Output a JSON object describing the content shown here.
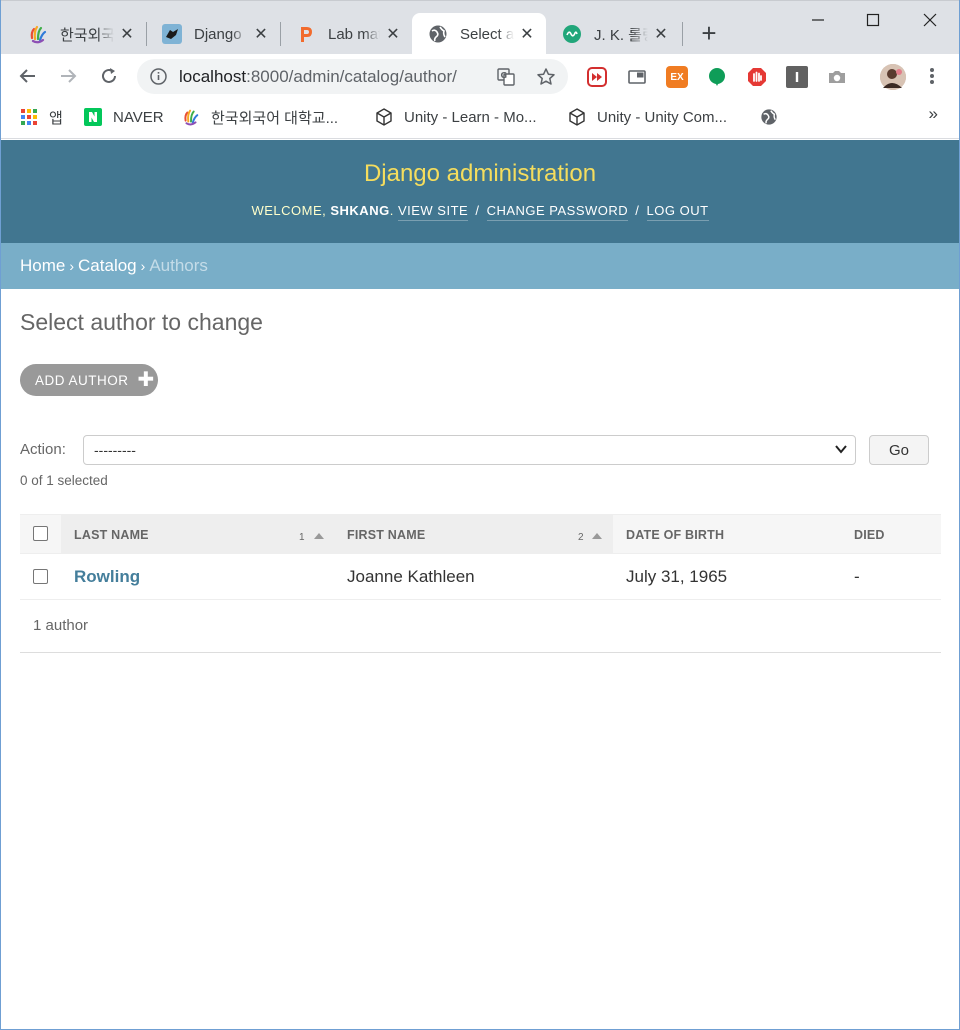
{
  "browser": {
    "tabs": [
      {
        "title": "한국외국어대학교",
        "icon": "hufs-hand-icon"
      },
      {
        "title": "Django",
        "icon": "django-icon"
      },
      {
        "title": "Lab materials",
        "icon": "p-letter-icon"
      },
      {
        "title": "Select author to change",
        "icon": "globe-icon",
        "active": true
      },
      {
        "title": "J. K. 롤링",
        "icon": "green-logo-icon"
      }
    ],
    "new_tab": "+",
    "url_host": "localhost",
    "url_rest": ":8000/admin/catalog/author/",
    "bookmarks": [
      {
        "label": "앱",
        "icon": "apps-grid-icon"
      },
      {
        "label": "NAVER",
        "icon": "naver-icon"
      },
      {
        "label": "한국외국어 대학교...",
        "icon": "hufs-hand-icon"
      },
      {
        "label": "Unity - Learn - Mo...",
        "icon": "unity-icon"
      },
      {
        "label": "Unity - Unity Com...",
        "icon": "unity-icon"
      },
      {
        "label": "",
        "icon": "globe-icon"
      }
    ],
    "bookmarks_more": "»",
    "extensions": {
      "ex_label": "EX"
    }
  },
  "admin": {
    "branding": "Django administration",
    "welcome": "Welcome,",
    "username": "shkang",
    "username_suffix": ".",
    "view_site": "View site",
    "change_password": "Change password",
    "log_out": "Log out",
    "slash": "/",
    "breadcrumbs": {
      "home": "Home",
      "catalog": "Catalog",
      "current": "Authors",
      "separator": "›"
    },
    "title": "Select author to change",
    "add_button": "Add author",
    "action_label": "Action:",
    "action_selected": "---------",
    "go_button": "Go",
    "selection_counter": "0 of 1 selected",
    "columns": [
      {
        "label": "Last name",
        "sort_priority": "1"
      },
      {
        "label": "First name",
        "sort_priority": "2"
      },
      {
        "label": "Date of birth"
      },
      {
        "label": "Died"
      }
    ],
    "rows": [
      {
        "last_name": "Rowling",
        "first_name": "Joanne Kathleen",
        "date_of_birth": "July 31, 1965",
        "died": "-"
      }
    ],
    "paginator": "1 author"
  }
}
